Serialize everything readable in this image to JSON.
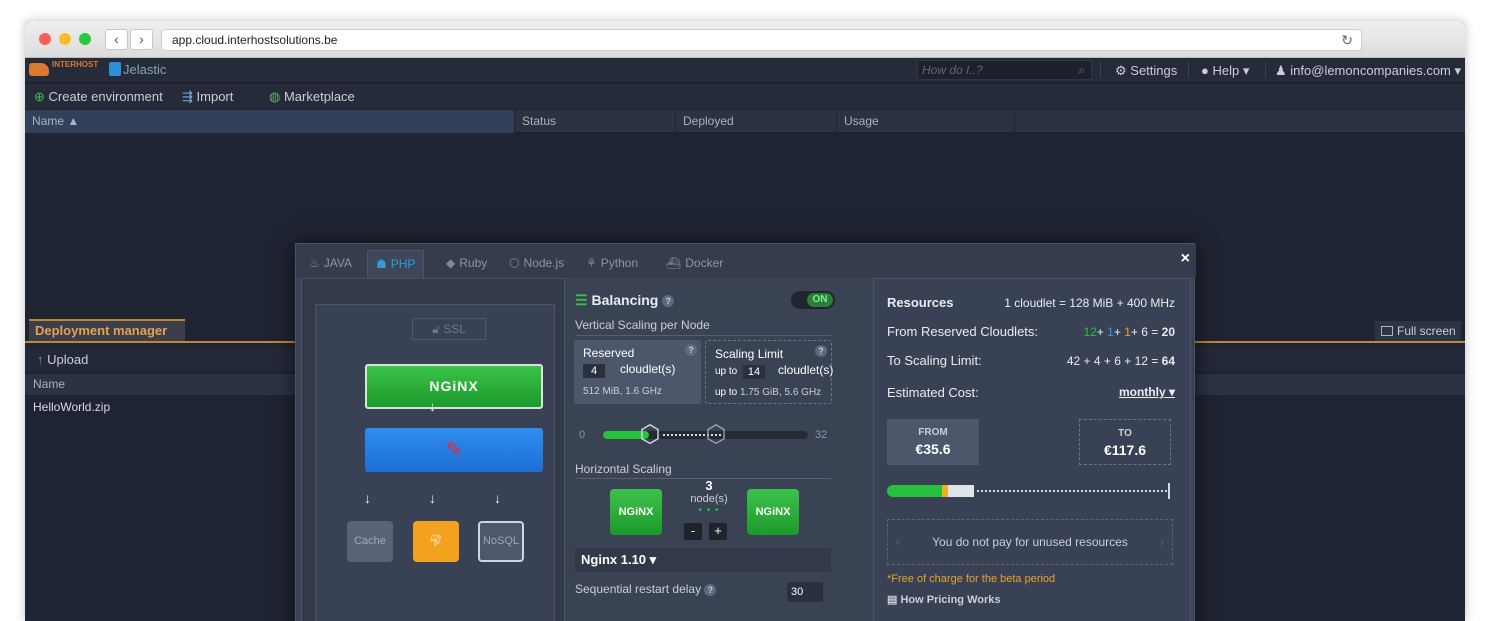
{
  "browser": {
    "url": "app.cloud.interhostsolutions.be",
    "back_icon": "chevron-left-icon",
    "forward_icon": "chevron-right-icon",
    "reload_icon": "reload-icon"
  },
  "topbar": {
    "brand1": "INTERHOST",
    "brand2": "Jelastic",
    "search_placeholder": "How do I..?",
    "settings": "Settings",
    "help": "Help",
    "account": "info@lemoncompanies.com"
  },
  "toolbar": {
    "create_env": "Create environment",
    "import": "Import",
    "marketplace": "Marketplace"
  },
  "grid": {
    "columns": [
      "Name",
      "Status",
      "Deployed",
      "Usage"
    ]
  },
  "deployment": {
    "tab": "Deployment manager",
    "full_screen": "Full screen",
    "upload": "Upload",
    "column_name": "Name",
    "rows": [
      "HelloWorld.zip"
    ]
  },
  "dialog": {
    "tabs": [
      "JAVA",
      "PHP",
      "Ruby",
      "Node.js",
      "Python",
      "Docker"
    ],
    "active_tab": "PHP",
    "close": "×",
    "ssl": "SSL",
    "nginx_label": "NGiNX",
    "cache": "Cache",
    "nosql": "NoSQL",
    "balancing": "Balancing",
    "toggle": "ON",
    "vertical_scaling": "Vertical Scaling per Node",
    "reserved": {
      "title": "Reserved",
      "value": "4",
      "unit": "cloudlet(s)",
      "info": "512 MiB, 1.6 GHz"
    },
    "limit": {
      "title": "Scaling Limit",
      "prefix": "up to",
      "value": "14",
      "unit": "cloudlet(s)",
      "info_prefix": "up to",
      "info": "1.75 GiB, 5.6 GHz"
    },
    "slider_min": "0",
    "slider_max": "32",
    "horizontal_scaling": "Horizontal Scaling",
    "nodes_count": "3",
    "nodes_label": "node(s)",
    "minus": "-",
    "plus": "+",
    "version": "Nginx 1.10",
    "restart_delay_label": "Sequential restart delay",
    "restart_delay_value": "30",
    "resources": {
      "title": "Resources",
      "cloudlet_def": "1 cloudlet = 128 MiB + 400 MHz",
      "from_label_pre": "From",
      "from_label": "Reserved Cloudlets:",
      "from_parts": [
        "12",
        "+",
        "1",
        "+",
        "1",
        "+",
        "6",
        "="
      ],
      "from_total": "20",
      "to_label_pre": "To",
      "to_label": "Scaling Limit:",
      "to_expr": "42 + 4 + 6 + 12 =",
      "to_total": "64",
      "estimated_cost": "Estimated Cost:",
      "period": "monthly",
      "from_cost_label": "FROM",
      "from_cost": "€35.6",
      "to_cost_label": "TO",
      "to_cost": "€117.6",
      "unused_note": "You do not pay for unused resources",
      "free_note": "*Free of charge for the beta period",
      "how_pricing": "How Pricing Works"
    }
  },
  "colors": {
    "accent_green": "#27c13d",
    "accent_blue": "#2f9bd9",
    "accent_orange": "#c1843a"
  }
}
